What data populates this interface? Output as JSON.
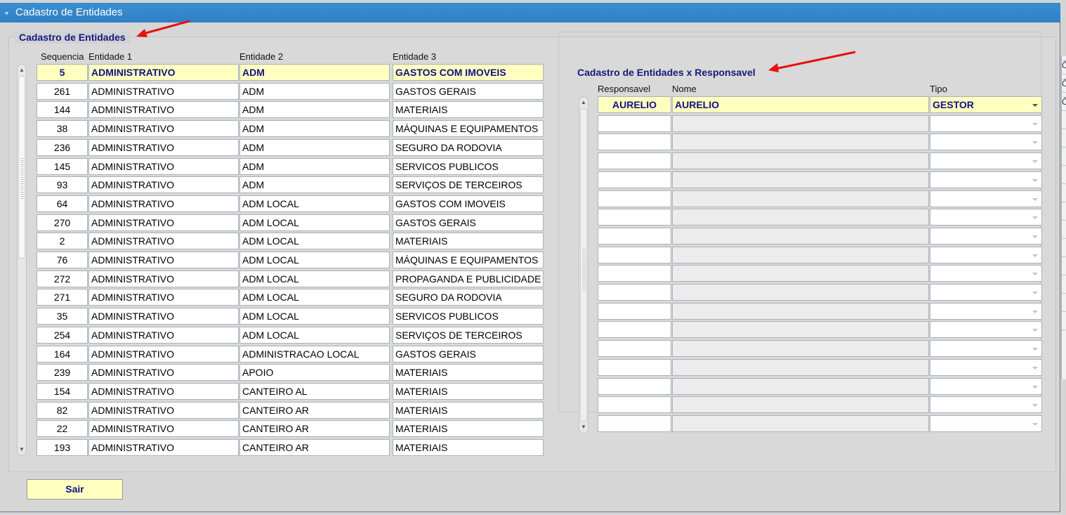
{
  "window": {
    "title": "Cadastro de Entidades"
  },
  "entidades": {
    "section_title": "Cadastro de Entidades",
    "headers": [
      "Sequencia",
      "Entidade 1",
      "Entidade 2",
      "Entidade 3"
    ],
    "rows": [
      [
        "5",
        "ADMINISTRATIVO",
        "ADM",
        "GASTOS COM IMOVEIS"
      ],
      [
        "261",
        "ADMINISTRATIVO",
        "ADM",
        "GASTOS GERAIS"
      ],
      [
        "144",
        "ADMINISTRATIVO",
        "ADM",
        "MATERIAIS"
      ],
      [
        "38",
        "ADMINISTRATIVO",
        "ADM",
        "MÁQUINAS E EQUIPAMENTOS"
      ],
      [
        "236",
        "ADMINISTRATIVO",
        "ADM",
        "SEGURO DA RODOVIA"
      ],
      [
        "145",
        "ADMINISTRATIVO",
        "ADM",
        "SERVICOS PUBLICOS"
      ],
      [
        "93",
        "ADMINISTRATIVO",
        "ADM",
        "SERVIÇOS DE TERCEIROS"
      ],
      [
        "64",
        "ADMINISTRATIVO",
        "ADM LOCAL",
        "GASTOS COM IMOVEIS"
      ],
      [
        "270",
        "ADMINISTRATIVO",
        "ADM LOCAL",
        "GASTOS GERAIS"
      ],
      [
        "2",
        "ADMINISTRATIVO",
        "ADM LOCAL",
        "MATERIAIS"
      ],
      [
        "76",
        "ADMINISTRATIVO",
        "ADM LOCAL",
        "MÁQUINAS E EQUIPAMENTOS"
      ],
      [
        "272",
        "ADMINISTRATIVO",
        "ADM LOCAL",
        "PROPAGANDA E PUBLICIDADE"
      ],
      [
        "271",
        "ADMINISTRATIVO",
        "ADM LOCAL",
        "SEGURO DA RODOVIA"
      ],
      [
        "35",
        "ADMINISTRATIVO",
        "ADM LOCAL",
        "SERVICOS PUBLICOS"
      ],
      [
        "254",
        "ADMINISTRATIVO",
        "ADM LOCAL",
        "SERVIÇOS DE TERCEIROS"
      ],
      [
        "164",
        "ADMINISTRATIVO",
        "ADMINISTRACAO LOCAL",
        "GASTOS GERAIS"
      ],
      [
        "239",
        "ADMINISTRATIVO",
        "APOIO",
        "MATERIAIS"
      ],
      [
        "154",
        "ADMINISTRATIVO",
        "CANTEIRO AL",
        "MATERIAIS"
      ],
      [
        "82",
        "ADMINISTRATIVO",
        "CANTEIRO AR",
        "MATERIAIS"
      ],
      [
        "22",
        "ADMINISTRATIVO",
        "CANTEIRO AR",
        "MATERIAIS"
      ],
      [
        "193",
        "ADMINISTRATIVO",
        "CANTEIRO AR",
        "MATERIAIS"
      ]
    ]
  },
  "responsavel": {
    "section_title": "Cadastro de Entidades x Responsavel",
    "headers": [
      "Responsavel",
      "Nome",
      "Tipo"
    ],
    "rows": [
      [
        "AURELIO",
        "AURELIO",
        "GESTOR"
      ],
      [
        "",
        "",
        ""
      ],
      [
        "",
        "",
        ""
      ],
      [
        "",
        "",
        ""
      ],
      [
        "",
        "",
        ""
      ],
      [
        "",
        "",
        ""
      ],
      [
        "",
        "",
        ""
      ],
      [
        "",
        "",
        ""
      ],
      [
        "",
        "",
        ""
      ],
      [
        "",
        "",
        ""
      ],
      [
        "",
        "",
        ""
      ],
      [
        "",
        "",
        ""
      ],
      [
        "",
        "",
        ""
      ],
      [
        "",
        "",
        ""
      ],
      [
        "",
        "",
        ""
      ],
      [
        "",
        "",
        ""
      ],
      [
        "",
        "",
        ""
      ],
      [
        "",
        "",
        ""
      ]
    ]
  },
  "actions": {
    "exit_label": "Sair"
  },
  "icons": {
    "window": "window-menu-icon",
    "scroll_up": "scroll-up-icon",
    "scroll_down": "scroll-down-icon",
    "annotation": "red-arrow-icon"
  },
  "colors": {
    "title_bar": "#2f7fc4",
    "selected_row": "#ffffc0",
    "section_title": "#18187a",
    "annotation_arrow": "#e81010"
  }
}
